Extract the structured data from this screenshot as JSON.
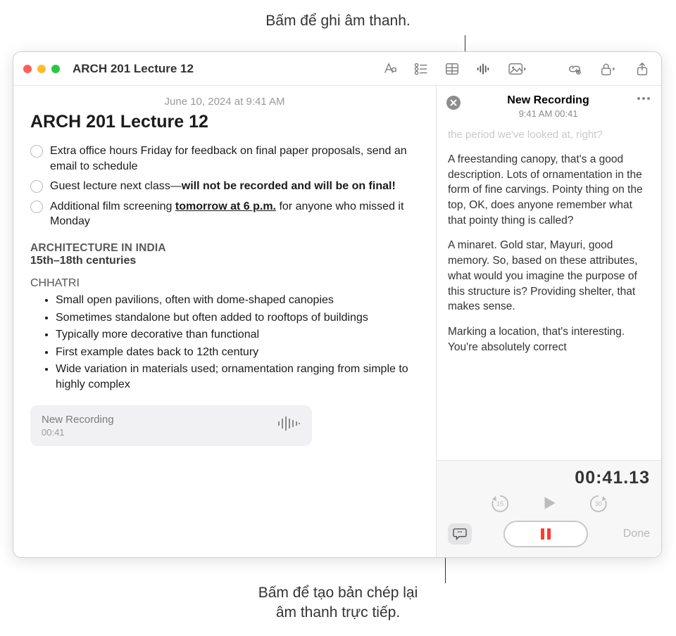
{
  "callouts": {
    "top": "Bấm để ghi âm thanh.",
    "bottom_line1": "Bấm để tạo bản chép lại",
    "bottom_line2": "âm thanh trực tiếp."
  },
  "window": {
    "title": "ARCH 201 Lecture 12"
  },
  "toolbar_icons": {
    "format": "format-text-icon",
    "checklist": "checklist-icon",
    "table": "table-icon",
    "audio": "audio-wave-icon",
    "media": "media-icon",
    "link": "link-icon",
    "lock": "lock-icon",
    "share": "share-icon"
  },
  "note": {
    "date": "June 10, 2024 at 9:41 AM",
    "title": "ARCH 201 Lecture 12",
    "checklist": [
      {
        "text_a": "Extra office hours Friday for feedback on final paper proposals, send an email to schedule"
      },
      {
        "text_a": "Guest lecture next class—",
        "text_b_bold": "will not be recorded and will be on final!"
      },
      {
        "text_a": "Additional film screening ",
        "text_b_boldunder": "tomorrow at 6 p.m.",
        "text_c": " for anyone who missed it Monday"
      }
    ],
    "section_heading": "ARCHITECTURE IN INDIA",
    "section_sub": "15th–18th centuries",
    "subsection": "CHHATRI",
    "bullets": [
      "Small open pavilions, often with dome-shaped canopies",
      "Sometimes standalone but often added to rooftops of buildings",
      "Typically more decorative than functional",
      "First example dates back to 12th century",
      "Wide variation in materials used; ornamentation ranging from simple to highly complex"
    ],
    "recording_card": {
      "title": "New Recording",
      "duration": "00:41"
    }
  },
  "recording_panel": {
    "title": "New Recording",
    "subtitle": "9:41 AM 00:41",
    "transcript": {
      "faded": "the period we've looked at, right?",
      "p1": "A freestanding canopy, that's a good description. Lots of ornamentation in the form of fine carvings. Pointy thing on the top, OK, does anyone remember what that pointy thing is called?",
      "p2": "A minaret. Gold star, Mayuri, good memory. So, based on these attributes, what would you imagine the purpose of this structure is? Providing shelter, that makes sense.",
      "p3": "Marking a location, that's interesting. You're absolutely correct"
    },
    "timer": "00:41.13",
    "skip_back": "15",
    "skip_fwd": "30",
    "done": "Done"
  }
}
